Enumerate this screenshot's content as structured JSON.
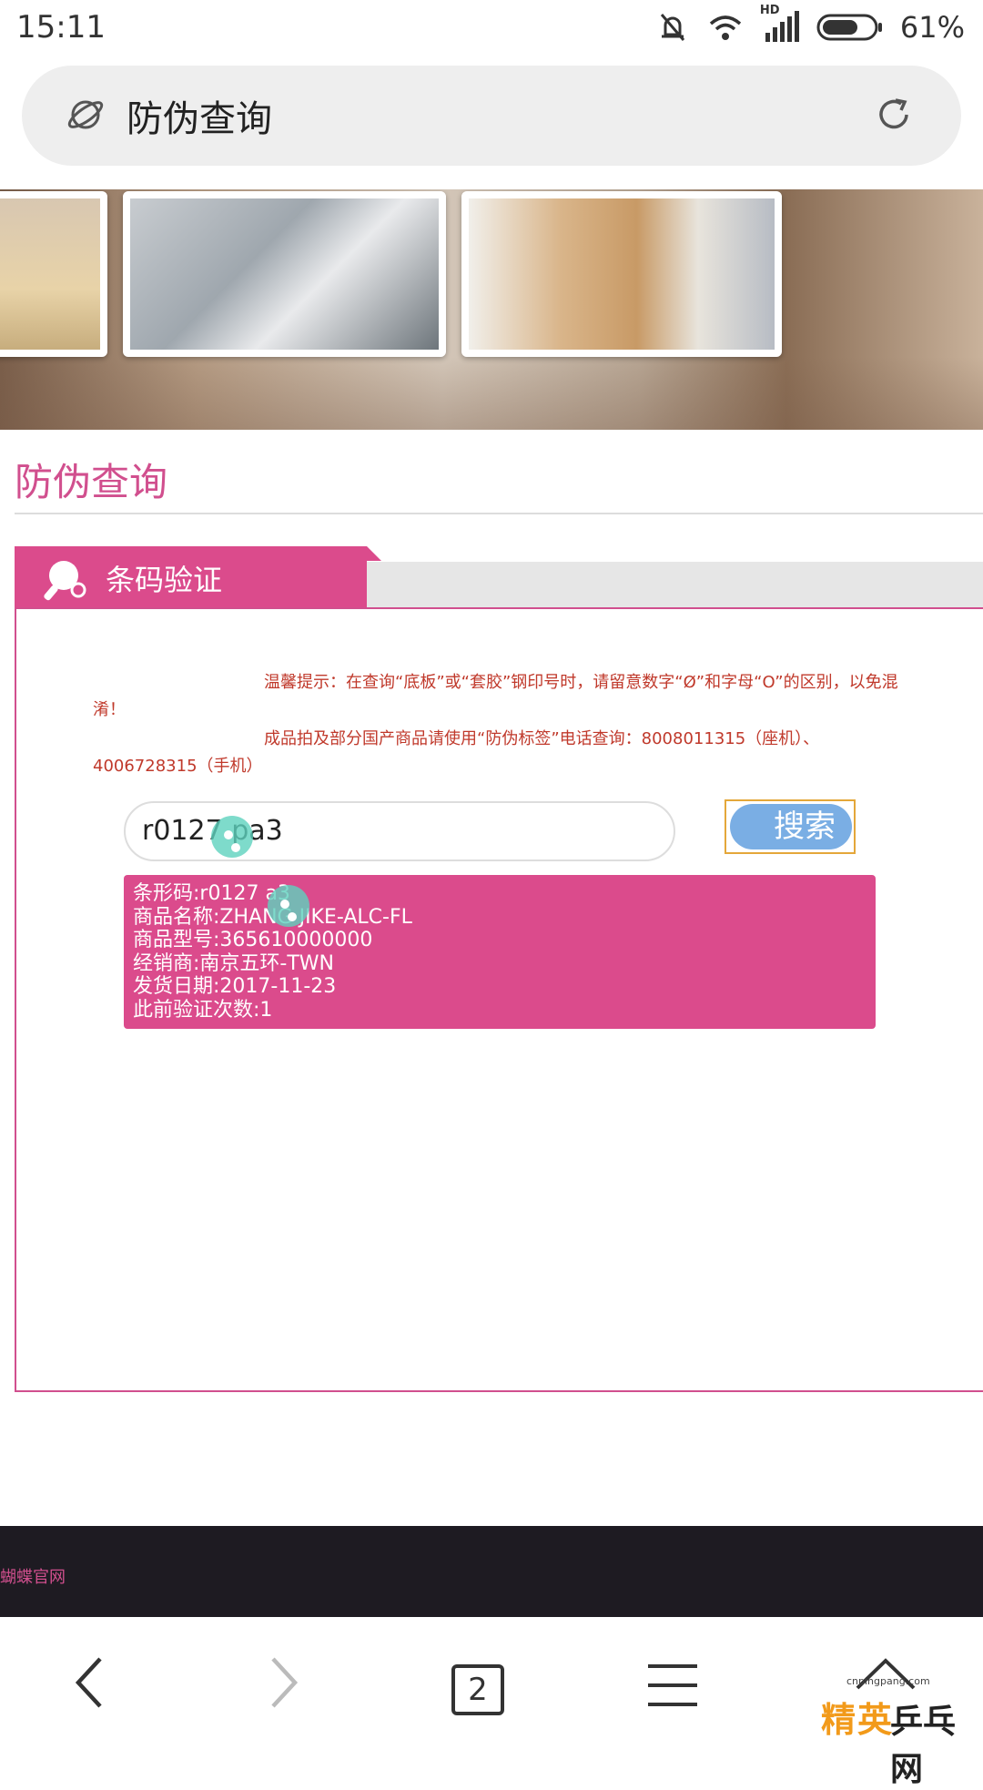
{
  "status_bar": {
    "time": "15:11",
    "network": "HD",
    "battery": "61%"
  },
  "address_bar": {
    "title": "防伪查询"
  },
  "page": {
    "heading": "防伪查询"
  },
  "panel": {
    "tab_label": "条码验证",
    "tip1": "温馨提示：在查询“底板”或“套胶”钢印号时，请留意数字“Ø”和字母“O”的区别，以免混淆！",
    "tip2": "成品拍及部分国产商品请使用“防伪标签”电话查询：8008011315（座机）、4006728315（手机）"
  },
  "search": {
    "value": "r0127   pa3",
    "button_label": "搜索"
  },
  "result": {
    "barcode": "条形码:r0127    a3",
    "product_name": "商品名称:ZHANG JIKE-ALC-FL",
    "model": "商品型号:365610000000",
    "dealer": "经销商:南京五环-TWN",
    "ship_date": "发货日期:2017-11-23",
    "verify_count": "此前验证次数:1"
  },
  "footer": {
    "text": "蝴蝶官网"
  },
  "nav": {
    "tab_count": "2"
  },
  "watermark": {
    "url": "cnpingpang.com",
    "main": "精英",
    "sub": "乒乓网"
  },
  "colors": {
    "brand": "#db4b8c",
    "button": "#7aaee4",
    "footer": "#1e1b22"
  }
}
